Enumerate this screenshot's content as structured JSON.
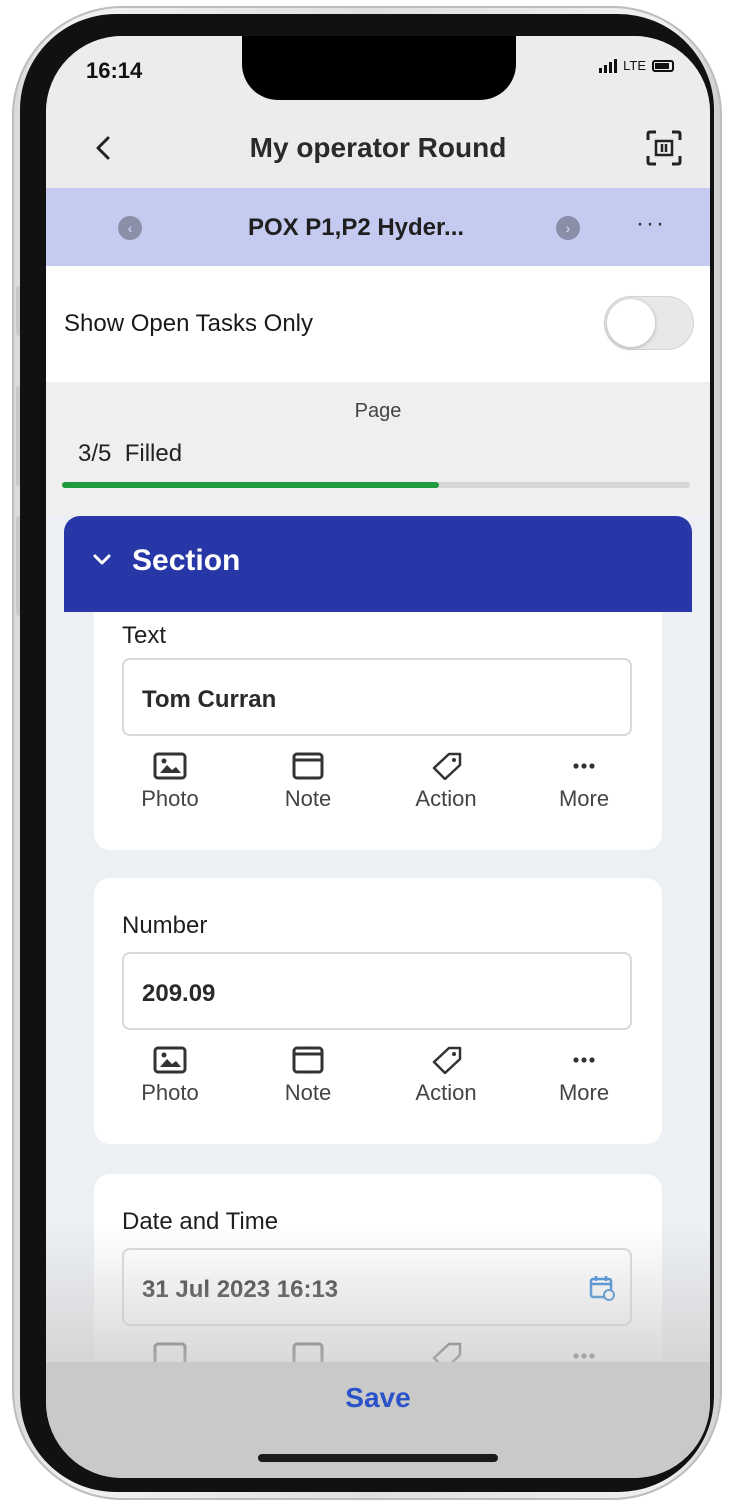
{
  "status_bar": {
    "time": "16:14",
    "network": "LTE"
  },
  "nav": {
    "title": "My operator Round",
    "back_icon": "chevron-left-icon",
    "scan_icon": "scan-icon"
  },
  "round_bar": {
    "title": "POX P1,P2 Hyder...",
    "more": "···"
  },
  "filter": {
    "label": "Show Open Tasks Only",
    "enabled": false
  },
  "progress": {
    "page_label": "Page",
    "filled_label": "3/5  Filled",
    "fraction": 0.6,
    "color": "#1f9a3c"
  },
  "section": {
    "title": "Section",
    "color": "#2837a8"
  },
  "actions": {
    "photo": "Photo",
    "note": "Note",
    "action": "Action",
    "more": "More"
  },
  "fields": [
    {
      "label": "Text",
      "value": "Tom Curran"
    },
    {
      "label": "Number",
      "value": "209.09"
    },
    {
      "label": "Date and Time",
      "value": "31 Jul 2023 16:13"
    }
  ],
  "footer": {
    "save": "Save",
    "accent": "#2a52c9"
  }
}
